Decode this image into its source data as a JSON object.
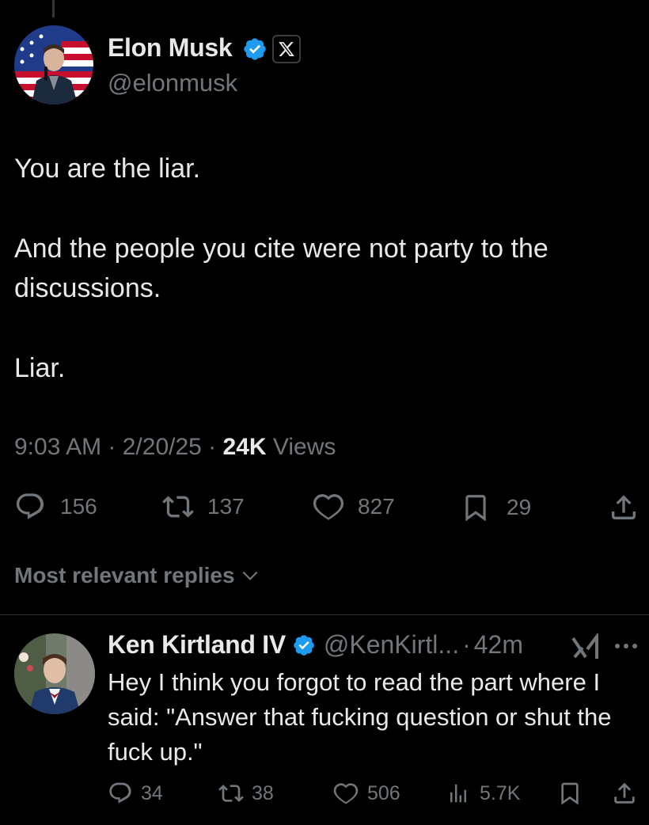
{
  "tweet": {
    "author_name": "Elon Musk",
    "author_handle": "@elonmusk",
    "paragraphs": [
      "You are the liar.",
      "And the people you cite were not party to the discussions.",
      "Liar."
    ],
    "time": "9:03 AM",
    "date": "2/20/25",
    "views_count": "24K",
    "views_label": "Views",
    "stats": {
      "replies": "156",
      "reposts": "137",
      "likes": "827",
      "bookmarks": "29"
    }
  },
  "replies_section": {
    "label": "Most relevant replies"
  },
  "reply": {
    "author_name": "Ken Kirtland IV",
    "author_handle": "@KenKirtl...",
    "time": "42m",
    "text": "Hey I think you forgot to read the part where I said: \"Answer that fucking question or shut the fuck up.\"",
    "stats": {
      "replies": "34",
      "reposts": "38",
      "likes": "506",
      "views": "5.7K"
    }
  },
  "colors": {
    "background": "#000000",
    "text_primary": "#e7e9ea",
    "text_secondary": "#71767b",
    "verified": "#1d9bf0",
    "divider": "#2f3336"
  },
  "icons": [
    "x-logo-icon",
    "verified-badge-icon",
    "reply-icon",
    "repost-icon",
    "like-icon",
    "bookmark-icon",
    "share-icon",
    "views-icon",
    "grok-icon",
    "more-icon",
    "chevron-down-icon"
  ]
}
